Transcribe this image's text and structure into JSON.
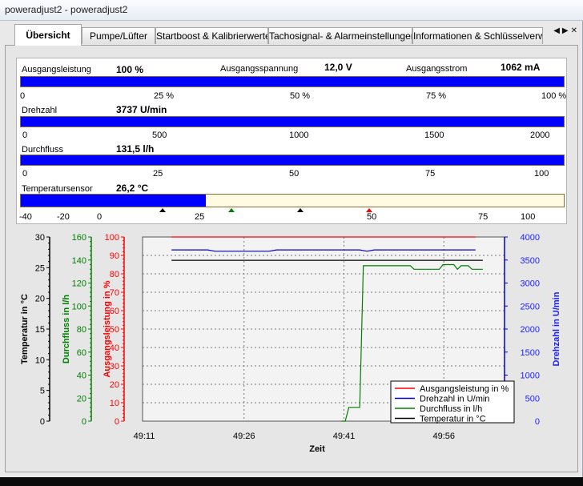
{
  "window": {
    "title": "poweradjust2 - poweradjust2"
  },
  "tabs": [
    {
      "label": "Übersicht",
      "active": true
    },
    {
      "label": "Pumpe/Lüfter",
      "active": false
    },
    {
      "label": "Startboost & Kalibrierwerte",
      "active": false
    },
    {
      "label": "Tachosignal- & Alarmeinstellungen",
      "active": false
    },
    {
      "label": "Informationen & Schlüsselverwalt",
      "active": false
    }
  ],
  "tab_scroll": {
    "left": "◀",
    "right": "▶",
    "close": "✕"
  },
  "gauges": {
    "ausgangsleistung": {
      "label": "Ausgangsleistung",
      "value": "100 %",
      "fraction": 1.0,
      "ticks": [
        "0",
        "25 %",
        "50 %",
        "75 %",
        "100 %"
      ]
    },
    "ausgangsspannung": {
      "label": "Ausgangsspannung",
      "value": "12,0 V"
    },
    "ausgangsstrom": {
      "label": "Ausgangsstrom",
      "value": "1062 mA"
    },
    "drehzahl": {
      "label": "Drehzahl",
      "value": "3737 U/min",
      "fraction": 1.0,
      "ticks": [
        "0",
        "500",
        "1000",
        "1500",
        "2000"
      ]
    },
    "durchfluss": {
      "label": "Durchfluss",
      "value": "131,5 l/h",
      "fraction": 1.0,
      "ticks": [
        "0",
        "25",
        "50",
        "75",
        "100"
      ]
    },
    "temperatursensor": {
      "label": "Temperatursensor",
      "value": "26,2 °C",
      "fraction": 0.34,
      "ticks": [
        "-40",
        "-20",
        "0",
        "25",
        "50",
        "75",
        "100"
      ]
    }
  },
  "chart_data": {
    "type": "line",
    "xlabel": "Zeit",
    "x_ticks": [
      "49:11",
      "49:26",
      "49:41",
      "49:56"
    ],
    "y_axes": [
      {
        "label": "Temperatur in °C",
        "color": "#000000",
        "ticks": [
          "0",
          "5",
          "10",
          "15",
          "20",
          "25",
          "30"
        ],
        "range": [
          0,
          30
        ]
      },
      {
        "label": "Durchfluss in l/h",
        "color": "#008000",
        "ticks": [
          "0",
          "20",
          "40",
          "60",
          "80",
          "100",
          "120",
          "140",
          "160"
        ],
        "range": [
          0,
          160
        ]
      },
      {
        "label": "Ausgangsleistung in %",
        "color": "#ff0000",
        "ticks": [
          "0",
          "10",
          "20",
          "30",
          "40",
          "50",
          "60",
          "70",
          "80",
          "90",
          "100"
        ],
        "range": [
          0,
          100
        ]
      },
      {
        "label": "Drehzahl in U/min",
        "color": "#0000cc",
        "ticks": [
          "0",
          "500",
          "1000",
          "1500",
          "2000",
          "2500",
          "3000",
          "3500",
          "4000"
        ],
        "range": [
          0,
          4000
        ]
      }
    ],
    "series": [
      {
        "name": "Ausgangsleistung in %",
        "color": "#ff0000",
        "axis": 2,
        "points": [
          [
            0.08,
            100
          ],
          [
            0.92,
            100
          ]
        ]
      },
      {
        "name": "Drehzahl in U/min",
        "color": "#0000cc",
        "axis": 3,
        "points": [
          [
            0.08,
            3720
          ],
          [
            0.18,
            3720
          ],
          [
            0.2,
            3690
          ],
          [
            0.35,
            3690
          ],
          [
            0.37,
            3720
          ],
          [
            0.6,
            3720
          ],
          [
            0.62,
            3690
          ],
          [
            0.64,
            3720
          ],
          [
            0.92,
            3720
          ]
        ]
      },
      {
        "name": "Durchfluss in l/h",
        "color": "#008000",
        "axis": 1,
        "points": [
          [
            0.55,
            0
          ],
          [
            0.56,
            0
          ],
          [
            0.57,
            12
          ],
          [
            0.6,
            12
          ],
          [
            0.61,
            135
          ],
          [
            0.74,
            135
          ],
          [
            0.75,
            132
          ],
          [
            0.82,
            132
          ],
          [
            0.83,
            136
          ],
          [
            0.86,
            136
          ],
          [
            0.87,
            132
          ],
          [
            0.88,
            135
          ],
          [
            0.9,
            135
          ],
          [
            0.91,
            132
          ],
          [
            0.94,
            132
          ]
        ]
      },
      {
        "name": "Temperatur in °C",
        "color": "#000000",
        "axis": 0,
        "points": [
          [
            0.08,
            26.2
          ],
          [
            0.94,
            26.2
          ]
        ]
      }
    ],
    "grid": true,
    "legend": "bottom-right"
  }
}
